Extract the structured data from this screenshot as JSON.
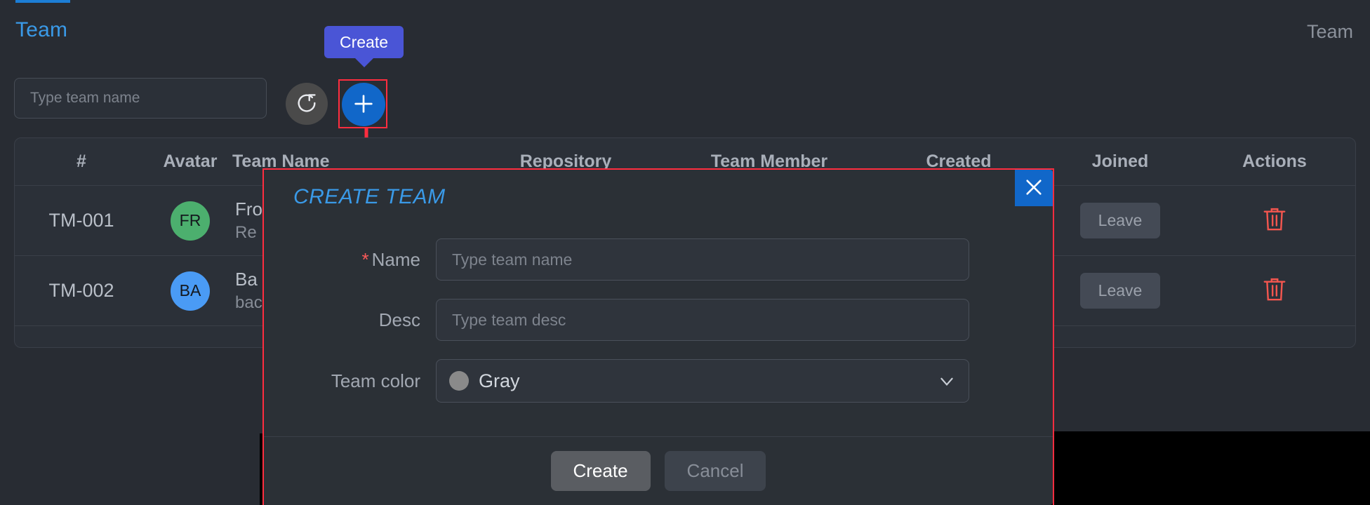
{
  "page": {
    "title": "Team",
    "breadcrumb_right": "Team"
  },
  "toolbar": {
    "search_placeholder": "Type team name",
    "search_value": "",
    "refresh_icon": "refresh-icon",
    "create_icon": "plus-icon",
    "tooltip_label": "Create"
  },
  "table": {
    "headers": [
      "#",
      "Avatar",
      "Team Name",
      "Repository",
      "Team Member",
      "Created",
      "Joined",
      "Actions"
    ],
    "rows": [
      {
        "id": "TM-001",
        "avatar_initials": "FR",
        "avatar_color": "#4caf6e",
        "team_name": "Fro",
        "team_desc": "Re",
        "repository": "",
        "team_member": "",
        "created": "",
        "joined_label": "Leave",
        "action_icon": "trash-icon"
      },
      {
        "id": "TM-002",
        "avatar_initials": "BA",
        "avatar_color": "#4a9bf5",
        "team_name": "Ba",
        "team_desc": "bac",
        "repository": "",
        "team_member": "",
        "created": "",
        "joined_label": "Leave",
        "action_icon": "trash-icon"
      }
    ]
  },
  "modal": {
    "title": "CREATE TEAM",
    "close_icon": "close-icon",
    "fields": {
      "name_label": "Name",
      "name_required_mark": "*",
      "name_placeholder": "Type team name",
      "name_value": "",
      "desc_label": "Desc",
      "desc_placeholder": "Type team desc",
      "desc_value": "",
      "color_label": "Team color",
      "color_value": "Gray",
      "color_swatch": "#8a8a8a",
      "color_chevron_icon": "chevron-down-icon"
    },
    "footer": {
      "create_label": "Create",
      "cancel_label": "Cancel"
    }
  },
  "colors": {
    "accent_blue": "#3a9ae8",
    "button_blue": "#1167c9",
    "tooltip_purple": "#4a55d6",
    "annotation_red": "#ff2d3f",
    "danger_red": "#ff5a5a",
    "page_bg": "#282c33",
    "panel_bg": "#2b3038"
  }
}
